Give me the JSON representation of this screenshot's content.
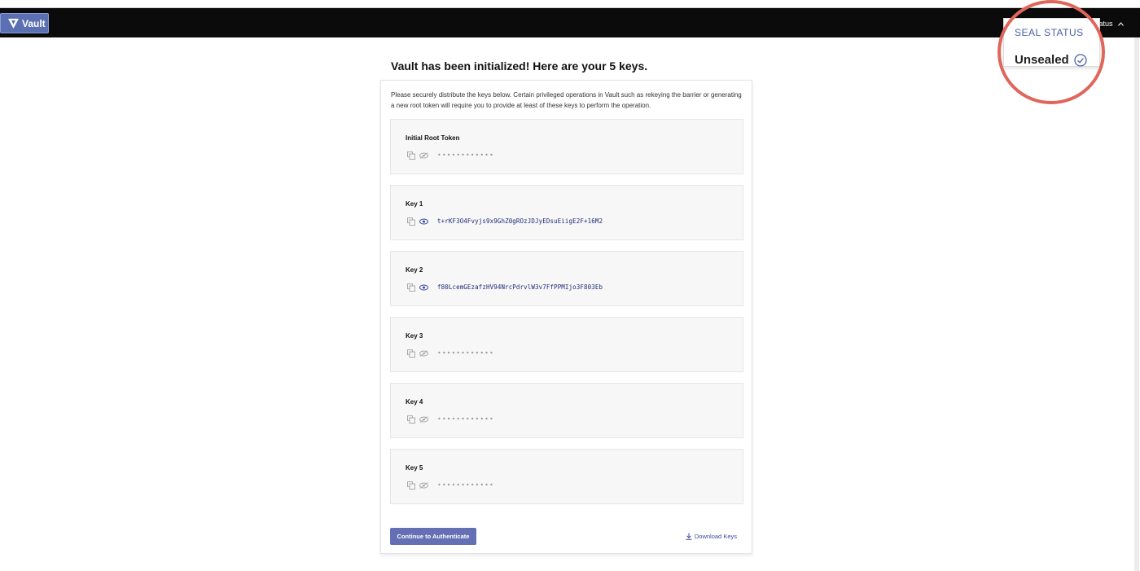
{
  "app": {
    "logo_text": "Vault",
    "logo_icon": "vault-triangle-icon"
  },
  "header": {
    "status_label": "Status",
    "status_icon": "chevron-up-icon"
  },
  "page": {
    "title": "Vault has been initialized! Here are your 5 keys.",
    "intro": "Please securely distribute the keys below. Certain privileged operations in Vault such as rekeying the barrier or generating a new root token will require you to provide at least of these keys to perform the operation."
  },
  "keys": [
    {
      "label": "Initial Root Token",
      "value": "",
      "masked": "••••••••••••",
      "revealed": false
    },
    {
      "label": "Key 1",
      "value": "t+rKF3O4Fvyjs9x9GhZ0gROzJDJyEDsuEiigE2F+16M2",
      "masked": "",
      "revealed": true
    },
    {
      "label": "Key 2",
      "value": "f80LcemGEzafzHV94NrcPdrvlW3v7FfPPMIjo3F803Eb",
      "masked": "",
      "revealed": true
    },
    {
      "label": "Key 3",
      "value": "",
      "masked": "••••••••••••",
      "revealed": false
    },
    {
      "label": "Key 4",
      "value": "",
      "masked": "••••••••••••",
      "revealed": false
    },
    {
      "label": "Key 5",
      "value": "",
      "masked": "••••••••••••",
      "revealed": false
    }
  ],
  "actions": {
    "continue_label": "Continue to Authenticate",
    "download_label": "Download Keys"
  },
  "seal": {
    "title": "SEAL STATUS",
    "state": "Unsealed",
    "state_icon": "check-circle-icon"
  },
  "colors": {
    "accent": "#6470b3",
    "highlight": "#e0665c",
    "topbar": "#0b0b0b"
  }
}
